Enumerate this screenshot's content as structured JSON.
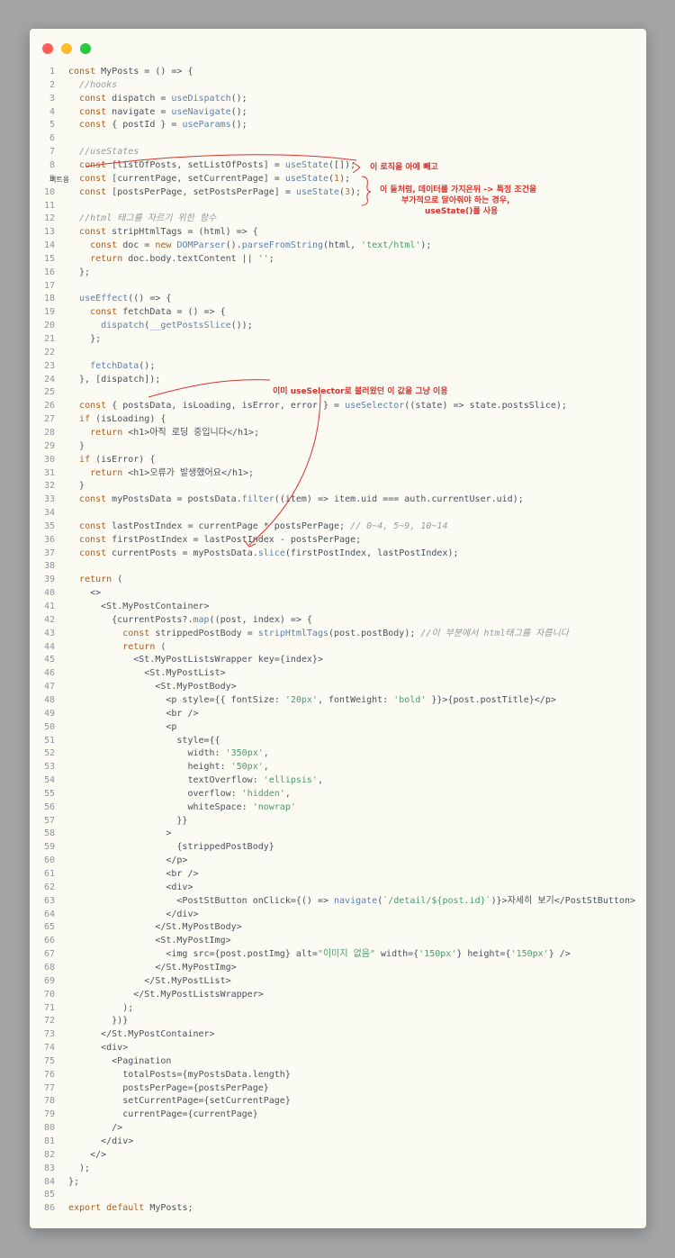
{
  "window_controls": {
    "close": "close-button",
    "minimize": "minimize-button",
    "zoom": "zoom-button"
  },
  "code_lines": [
    "const MyPosts = () => {",
    "  //hooks",
    "  const dispatch = useDispatch();",
    "  const navigate = useNavigate();",
    "  const { postId } = useParams();",
    "",
    "  //useStates",
    "  const [listOfPosts, setListOfPosts] = useState([]);",
    "  const [currentPage, setCurrentPage] = useState(1);",
    "  const [postsPerPage, setPostsPerPage] = useState(3);",
    "",
    "  //html 태그를 자르기 위한 함수",
    "  const stripHtmlTags = (html) => {",
    "    const doc = new DOMParser().parseFromString(html, 'text/html');",
    "    return doc.body.textContent || '';",
    "  };",
    "",
    "  useEffect(() => {",
    "    const fetchData = () => {",
    "      dispatch(__getPostsSlice());",
    "    };",
    "",
    "    fetchData();",
    "  }, [dispatch]);",
    "",
    "  const { postsData, isLoading, isError, error } = useSelector((state) => state.postsSlice);",
    "  if (isLoading) {",
    "    return <h1>아직 로딩 중입니다</h1>;",
    "  }",
    "  if (isError) {",
    "    return <h1>오류가 발생했어요</h1>;",
    "  }",
    "  const myPostsData = postsData.filter((item) => item.uid === auth.currentUser.uid);",
    "",
    "  const lastPostIndex = currentPage * postsPerPage; // 0~4, 5~9, 10~14",
    "  const firstPostIndex = lastPostIndex - postsPerPage;",
    "  const currentPosts = myPostsData.slice(firstPostIndex, lastPostIndex);",
    "",
    "  return (",
    "    <>",
    "      <St.MyPostContainer>",
    "        {currentPosts?.map((post, index) => {",
    "          const strippedPostBody = stripHtmlTags(post.postBody); //이 부분에서 html태그를 자릅니다",
    "          return (",
    "            <St.MyPostListsWrapper key={index}>",
    "              <St.MyPostList>",
    "                <St.MyPostBody>",
    "                  <p style={{ fontSize: '20px', fontWeight: 'bold' }}>{post.postTitle}</p>",
    "                  <br />",
    "                  <p",
    "                    style={{",
    "                      width: '350px',",
    "                      height: '50px',",
    "                      textOverflow: 'ellipsis',",
    "                      overflow: 'hidden',",
    "                      whiteSpace: 'nowrap'",
    "                    }}",
    "                  >",
    "                    {strippedPostBody}",
    "                  </p>",
    "                  <br />",
    "                  <div>",
    "                    <PostStButton onClick={() => navigate(`/detail/${post.id}`)}>자세히 보기</PostStButton>",
    "                  </div>",
    "                </St.MyPostBody>",
    "                <St.MyPostImg>",
    "                  <img src={post.postImg} alt=\"이미지 없음\" width={'150px'} height={'150px'} />",
    "                </St.MyPostImg>",
    "              </St.MyPostList>",
    "            </St.MyPostListsWrapper>",
    "          );",
    "        })}",
    "      </St.MyPostContainer>",
    "      <div>",
    "        <Pagination",
    "          totalPosts={myPostsData.length}",
    "          postsPerPage={postsPerPage}",
    "          setCurrentPage={setCurrentPage}",
    "          currentPage={currentPage}",
    "        />",
    "      </div>",
    "    </>",
    "  );",
    "};",
    "",
    "export default MyPosts;"
  ],
  "annotations": {
    "note1": "이 로직을 아예 빼고",
    "side_label": "퍼트용",
    "note2_line1": "이 둘처럼, 데이터를 가지온뒤 -> 특정 조건을",
    "note2_line2": "부가적으로 달아줘야 하는 경우,",
    "note2_line3": "useState()를 사용",
    "note3": "이미 useSelector로 불러왔던 이 값을 그냥 이용"
  },
  "colors": {
    "window_bg": "#fbfbf4",
    "page_bg": "#a3a4a5",
    "annotation": "#d8332c",
    "keyword": "#b35a19",
    "function": "#5a7fb0",
    "string": "#4a9a69",
    "comment": "#95989f"
  }
}
